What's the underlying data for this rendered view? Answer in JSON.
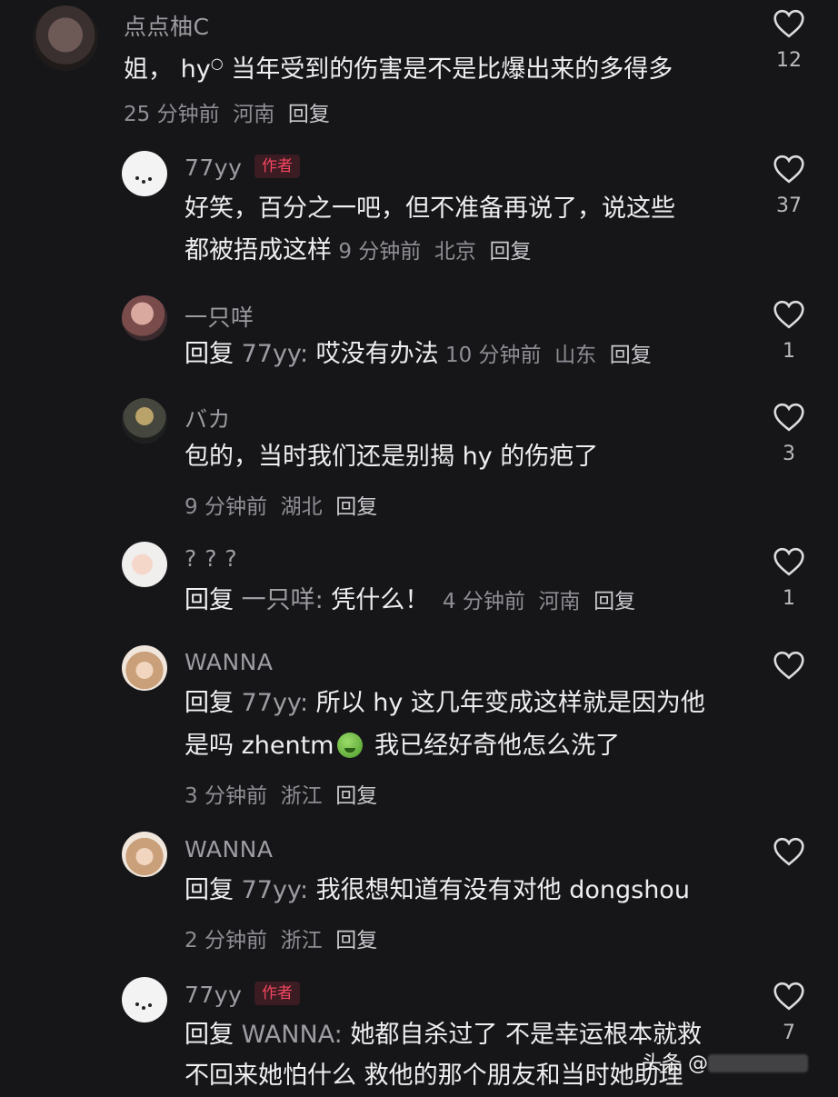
{
  "comments": [
    {
      "user": "点点柚C",
      "text_lines": [
        "姐， hy",
        " 当年受到的伤害是不是比爆出来的多得多"
      ],
      "meta": {
        "time": "25 分钟前",
        "location": "河南",
        "reply": "回复"
      },
      "likes": "12"
    },
    {
      "user": "77yy",
      "tag": "作者",
      "text_lines": [
        "好笑，百分之一吧，但不准备再说了，说这些",
        "都被捂成这样"
      ],
      "meta": {
        "time": "9 分钟前",
        "location": "北京",
        "reply": "回复"
      },
      "likes": "37"
    },
    {
      "user": "一只咩",
      "reply_prefix": "回复",
      "reply_target": "77yy:",
      "text": "哎没有办法",
      "meta": {
        "time": "10 分钟前",
        "location": "山东",
        "reply": "回复"
      },
      "likes": "1"
    },
    {
      "user": "バカ",
      "text": "包的，当时我们还是别揭 hy 的伤疤了",
      "meta": {
        "time": "9 分钟前",
        "location": "湖北",
        "reply": "回复"
      },
      "likes": "3"
    },
    {
      "user": "? ? ?",
      "reply_prefix": "回复",
      "reply_target": "一只咩:",
      "text": "凭什么！",
      "meta": {
        "time": "4 分钟前",
        "location": "河南",
        "reply": "回复"
      },
      "likes": "1"
    },
    {
      "user": "WANNA",
      "reply_prefix": "回复",
      "reply_target": "77yy:",
      "text_lines": [
        "所以 hy 这几年变成这样就是因为他",
        "是吗  zhentm",
        " 我已经好奇他怎么洗了"
      ],
      "meta": {
        "time": "3 分钟前",
        "location": "浙江",
        "reply": "回复"
      },
      "likes": ""
    },
    {
      "user": "WANNA",
      "reply_prefix": "回复",
      "reply_target": "77yy:",
      "text": "我很想知道有没有对他 dongshou",
      "meta": {
        "time": "2 分钟前",
        "location": "浙江",
        "reply": "回复"
      },
      "likes": ""
    },
    {
      "user": "77yy",
      "tag": "作者",
      "reply_prefix": "回复",
      "reply_target": "WANNA:",
      "text_lines": [
        "她都自杀过了 不是幸运根本就救",
        "不回来她怕什么 救他的那个朋友和当时她助理"
      ],
      "likes": "7"
    }
  ],
  "watermark": "头条 @",
  "icons": {
    "like": "heart-outline-icon",
    "search_hint": "search-hint-icon",
    "emoji": "nauseated-face-emoji"
  }
}
